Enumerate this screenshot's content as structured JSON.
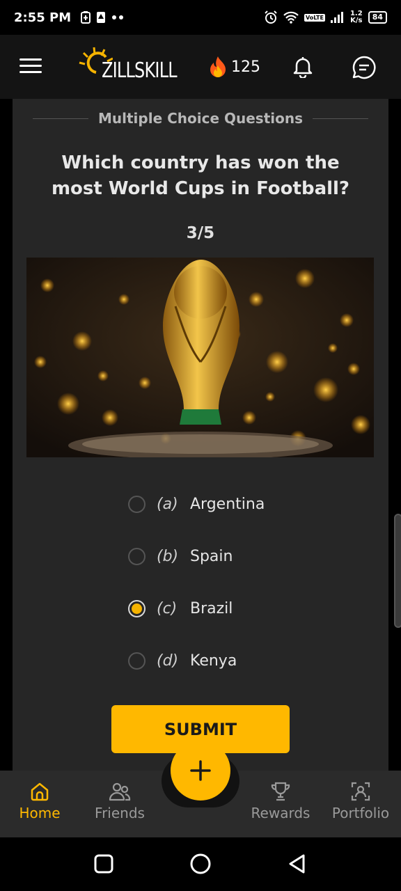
{
  "status_bar": {
    "time": "2:55 PM",
    "volte": "VoLTE",
    "speed_value": "1.2",
    "speed_unit": "K/s",
    "battery": "84"
  },
  "header": {
    "logo_text": "ZILLSKILL",
    "coins": "125"
  },
  "quiz": {
    "section_title": "Multiple Choice Questions",
    "question": "Which country has won the most World Cups in Football?",
    "progress": "3/5",
    "options": [
      {
        "letter": "(a)",
        "text": "Argentina",
        "selected": false
      },
      {
        "letter": "(b)",
        "text": "Spain",
        "selected": false
      },
      {
        "letter": "(c)",
        "text": "Brazil",
        "selected": true
      },
      {
        "letter": "(d)",
        "text": "Kenya",
        "selected": false
      }
    ],
    "submit_label": "SUBMIT"
  },
  "bottom_nav": {
    "items": [
      {
        "label": "Home",
        "icon": "home-icon",
        "active": true
      },
      {
        "label": "Friends",
        "icon": "friends-icon",
        "active": false
      },
      {
        "label": "Rewards",
        "icon": "trophy-icon",
        "active": false
      },
      {
        "label": "Portfolio",
        "icon": "portfolio-icon",
        "active": false
      }
    ],
    "fab_icon": "plus-icon"
  },
  "colors": {
    "accent": "#ffb800",
    "background": "#262626",
    "header": "#141414"
  }
}
